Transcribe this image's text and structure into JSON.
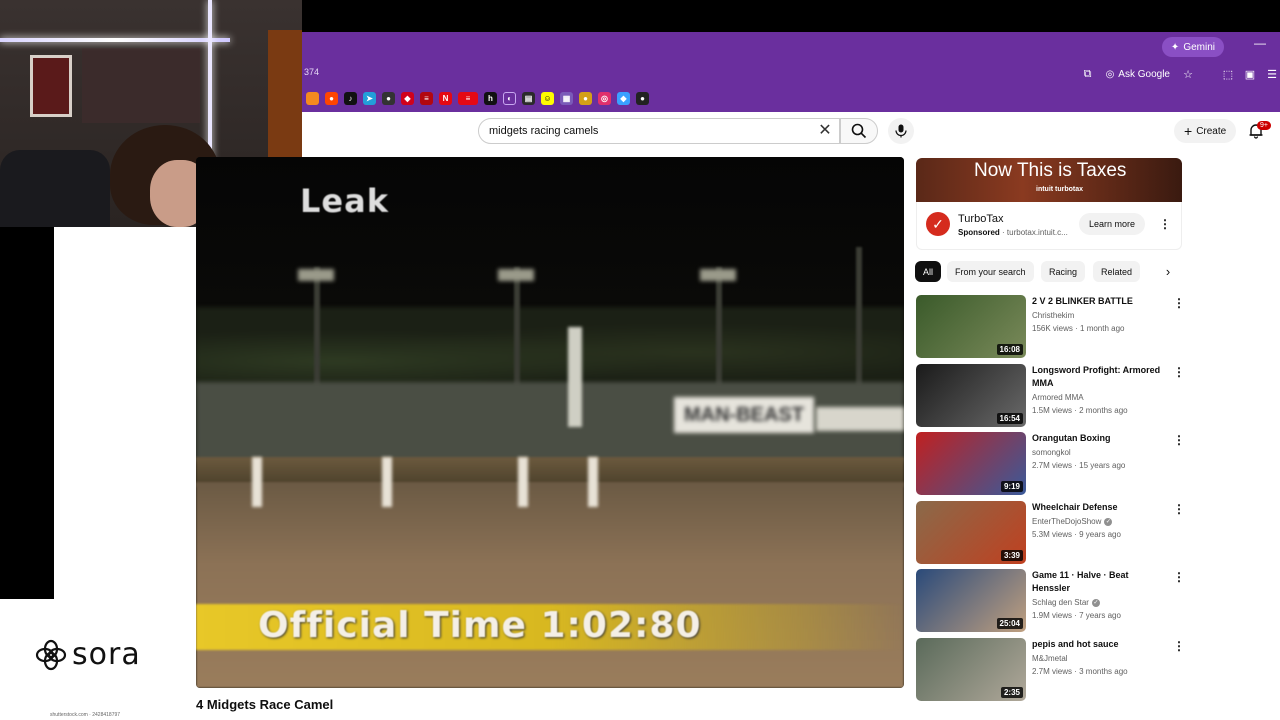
{
  "browser": {
    "gemini_label": "Gemini",
    "address_fragment": "374",
    "ask_google_label": "Ask Google"
  },
  "youtube": {
    "search_value": "midgets racing camels",
    "create_label": "Create",
    "notification_count": "9+"
  },
  "video": {
    "title": "4 Midgets Race Camel",
    "overlay_watermark": "Leak",
    "overlay_sign": "MAN-BEAST",
    "overlay_time": "Official Time 1:02:80"
  },
  "ad": {
    "banner_text": "Now This is Taxes",
    "banner_brand": "intuit turbotax",
    "advertiser": "TurboTax",
    "sponsored_label": "Sponsored",
    "domain": "turbotax.intuit.c...",
    "cta_label": "Learn more"
  },
  "chips": [
    "All",
    "From your search",
    "Racing",
    "Related"
  ],
  "related": [
    {
      "title": "2 V 2 BLINKER BATTLE",
      "channel": "Christhekim",
      "verified": false,
      "meta": "156K views · 1 month ago",
      "duration": "16:08",
      "thumb": [
        "#3a5a2a",
        "#7a8a5a"
      ]
    },
    {
      "title": "Longsword Profight: Armored MMA",
      "channel": "Armored MMA",
      "verified": false,
      "meta": "1.5M views · 2 months ago",
      "duration": "16:54",
      "thumb": [
        "#1a1a1a",
        "#6a6a6a"
      ]
    },
    {
      "title": "Orangutan Boxing",
      "channel": "somongkol",
      "verified": false,
      "meta": "2.7M views · 15 years ago",
      "duration": "9:19",
      "thumb": [
        "#c02020",
        "#3a5a9a"
      ]
    },
    {
      "title": "Wheelchair Defense",
      "channel": "EnterTheDojoShow",
      "verified": true,
      "meta": "5.3M views · 9 years ago",
      "duration": "3:39",
      "thumb": [
        "#8a6a4a",
        "#c04020"
      ]
    },
    {
      "title": "Game 11 · Halve · Beat Henssler",
      "channel": "Schlag den Star",
      "verified": true,
      "meta": "1.9M views · 7 years ago",
      "duration": "25:04",
      "thumb": [
        "#2a4a7a",
        "#c0a080"
      ]
    },
    {
      "title": "pepis and hot sauce",
      "channel": "M&Jmetal",
      "verified": false,
      "meta": "2.7M views · 3 months ago",
      "duration": "2:35",
      "thumb": [
        "#5a6a5a",
        "#b0a89a"
      ]
    }
  ],
  "overlay": {
    "brand": "sora",
    "small_text": "shutterstock.com · 2428418797"
  }
}
